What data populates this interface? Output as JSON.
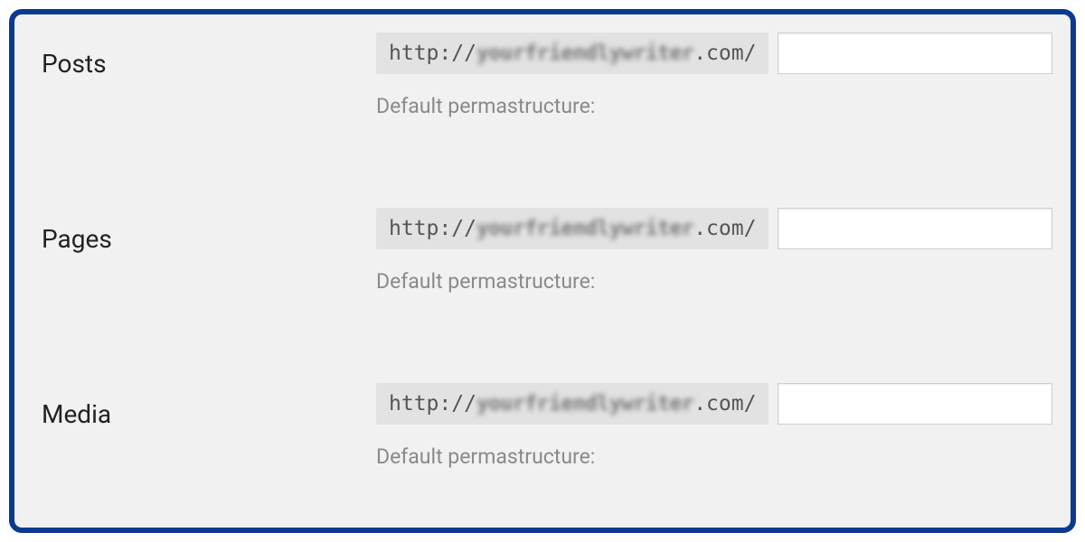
{
  "rows": [
    {
      "label": "Posts",
      "url_scheme": "http://",
      "url_domain_obscured": "yourfriendlywriter",
      "url_suffix": ".com/",
      "input_value": "",
      "helper": "Default permastructure:"
    },
    {
      "label": "Pages",
      "url_scheme": "http://",
      "url_domain_obscured": "yourfriendlywriter",
      "url_suffix": ".com/",
      "input_value": "",
      "helper": "Default permastructure:"
    },
    {
      "label": "Media",
      "url_scheme": "http://",
      "url_domain_obscured": "yourfriendlywriter",
      "url_suffix": ".com/",
      "input_value": "",
      "helper": "Default permastructure:"
    }
  ]
}
